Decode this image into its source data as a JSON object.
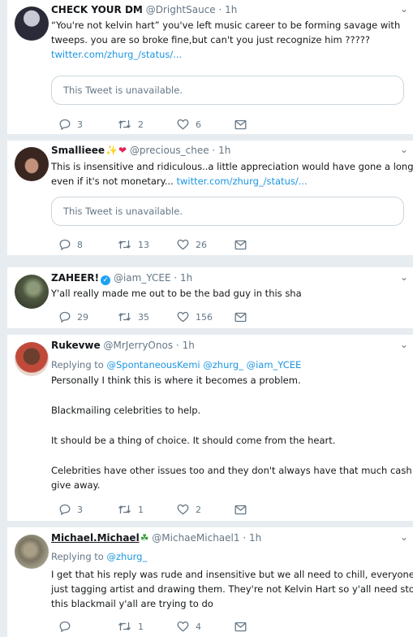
{
  "tweets": [
    {
      "name": "CHECK YOUR DM",
      "handle": "@DrightSauce",
      "time": "1h",
      "lines": [
        "“You're not kelvin hart” you've left music career to be forming savage with",
        "tweeps. you are so broke fine,but can't you just recognize him ?????"
      ],
      "link": "twitter.com/zhurg_/status/...",
      "quote": "This Tweet is unavailable.",
      "replies": "3",
      "retweets": "2",
      "likes": "6"
    },
    {
      "name": "Smallieee",
      "handle": "@precious_chee",
      "time": "1h",
      "lines": [
        "This is insensitive and ridiculous..a little appreciation would have gone a long way",
        "even if it's not monetary..."
      ],
      "link": "twitter.com/zhurg_/status/...",
      "quote": "This Tweet is unavailable.",
      "replies": "8",
      "retweets": "13",
      "likes": "26"
    },
    {
      "name": "ZAHEER!",
      "handle": "@iam_YCEE",
      "time": "1h",
      "lines": [
        "Y'all really made me out to be the bad guy in this sha"
      ],
      "replies": "29",
      "retweets": "35",
      "likes": "156"
    },
    {
      "name": "Rukevwe",
      "handle": "@MrJerryOnos",
      "time": "1h",
      "replying_prefix": "Replying to",
      "replying_to": "@SpontaneousKemi @zhurg_ @iam_YCEE",
      "paragraphs": [
        "Personally I think this is where it becomes a problem.",
        "Blackmailing celebrities to help.",
        "It should be a thing of choice. It should come from the heart.",
        "Celebrities have other issues too and they don't always have that much cash to",
        "give away."
      ],
      "replies": "3",
      "retweets": "1",
      "likes": "2"
    },
    {
      "name": "Michael.Michael",
      "handle": "@MichaeMichael1",
      "time": "1h",
      "replying_prefix": "Replying to",
      "replying_to": "@zhurg_",
      "lines": [
        "I get that his reply was rude and insensitive but we all need to chill, everyone is",
        "just tagging artist and drawing them. They're not Kelvin Hart so y'all need stop",
        "this blackmail y'all are trying to do"
      ],
      "replies": "",
      "retweets": "1",
      "likes": "4"
    }
  ],
  "dot": "·",
  "colors": {
    "link": "#1b95e0",
    "muted": "#657786",
    "verified": "#1da1f2",
    "background": "#e6ecf0"
  },
  "icons": [
    "reply-icon",
    "retweet-icon",
    "like-icon",
    "dm-icon",
    "chevron-down-icon",
    "verified-badge-icon",
    "sparkles-emoji",
    "heart-emoji",
    "shamrock-emoji"
  ]
}
